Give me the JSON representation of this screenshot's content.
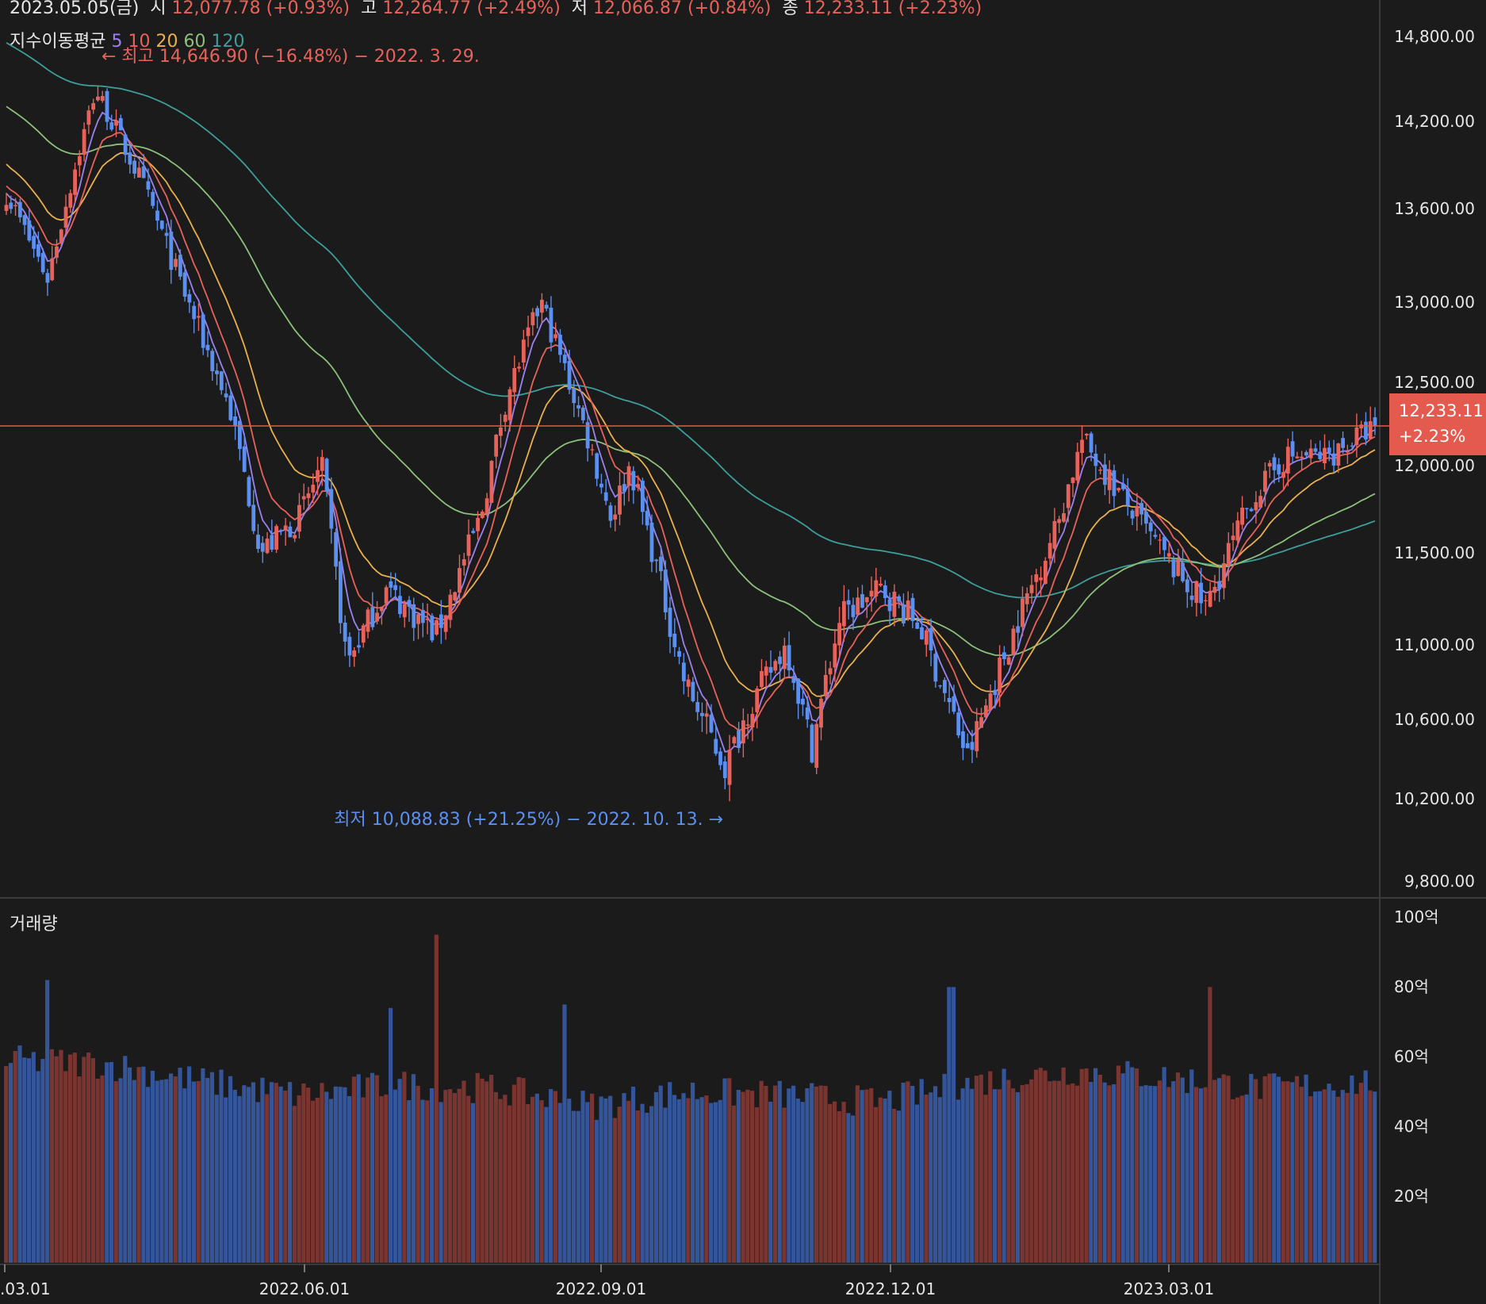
{
  "header": {
    "date": "2023.05.05(금)",
    "open_label": "시",
    "open_value": "12,077.78 (+0.93%)",
    "high_label": "고",
    "high_value": "12,264.77 (+2.49%)",
    "low_label": "저",
    "low_value": "12,066.87 (+0.84%)",
    "close_label": "종",
    "close_value": "12,233.11 (+2.23%)"
  },
  "ma_legend": {
    "title": "지수이동평균",
    "items": [
      {
        "label": "5",
        "color": "#9b82f0"
      },
      {
        "label": "10",
        "color": "#e8625a"
      },
      {
        "label": "20",
        "color": "#eab04c"
      },
      {
        "label": "60",
        "color": "#8cc07a"
      },
      {
        "label": "120",
        "color": "#3d9e9a"
      }
    ]
  },
  "colors": {
    "up": "#e8625a",
    "down": "#5b8ff0",
    "vol_up": "#7a3530",
    "vol_down": "#34559a",
    "background": "#1b1b1c",
    "grid_line": "#3a3a3c"
  },
  "annotations": {
    "high": "← 최고 14,646.90 (−16.48%) − 2022. 3. 29.",
    "low": "최저 10,088.83 (+21.25%) − 2022. 10. 13. →"
  },
  "last_price": {
    "value": "12,233.11",
    "change": "+2.23%"
  },
  "volume_label": "거래량",
  "chart_data": [
    {
      "type": "candlestick",
      "title": "",
      "x_ticks": [
        ".03.01",
        "2022.06.01",
        "2022.09.01",
        "2022.12.01",
        "2023.03.01"
      ],
      "y_ticks": [
        "14,800.00",
        "14,200.00",
        "13,600.00",
        "13,000.00",
        "12,500.00",
        "12,000.00",
        "11,500.00",
        "11,000.00",
        "10,600.00",
        "10,200.00",
        "9,800.00"
      ],
      "y_axis_note": "non-linear price scale as printed",
      "close_path": [
        {
          "date": "2022-03-01",
          "close": 13700
        },
        {
          "date": "2022-03-14",
          "close": 13150
        },
        {
          "date": "2022-03-29",
          "close": 14420
        },
        {
          "date": "2022-04-12",
          "close": 13800
        },
        {
          "date": "2022-04-26",
          "close": 13050
        },
        {
          "date": "2022-05-10",
          "close": 12350
        },
        {
          "date": "2022-05-20",
          "close": 11500
        },
        {
          "date": "2022-06-01",
          "close": 11700
        },
        {
          "date": "2022-06-08",
          "close": 12000
        },
        {
          "date": "2022-06-16",
          "close": 10900
        },
        {
          "date": "2022-06-28",
          "close": 11300
        },
        {
          "date": "2022-07-14",
          "close": 11050
        },
        {
          "date": "2022-07-28",
          "close": 11700
        },
        {
          "date": "2022-08-05",
          "close": 12400
        },
        {
          "date": "2022-08-16",
          "close": 13000
        },
        {
          "date": "2022-08-30",
          "close": 12200
        },
        {
          "date": "2022-09-07",
          "close": 11700
        },
        {
          "date": "2022-09-13",
          "close": 12000
        },
        {
          "date": "2022-09-30",
          "close": 10800
        },
        {
          "date": "2022-10-13",
          "close": 10350
        },
        {
          "date": "2022-10-20",
          "close": 10650
        },
        {
          "date": "2022-11-01",
          "close": 11000
        },
        {
          "date": "2022-11-09",
          "close": 10450
        },
        {
          "date": "2022-11-18",
          "close": 11150
        },
        {
          "date": "2022-12-01",
          "close": 11300
        },
        {
          "date": "2022-12-13",
          "close": 11100
        },
        {
          "date": "2022-12-28",
          "close": 10400
        },
        {
          "date": "2023-01-12",
          "close": 11100
        },
        {
          "date": "2023-01-25",
          "close": 11650
        },
        {
          "date": "2023-02-02",
          "close": 12150
        },
        {
          "date": "2023-02-15",
          "close": 11800
        },
        {
          "date": "2023-03-01",
          "close": 11450
        },
        {
          "date": "2023-03-13",
          "close": 11200
        },
        {
          "date": "2023-03-27",
          "close": 11800
        },
        {
          "date": "2023-04-07",
          "close": 12050
        },
        {
          "date": "2023-04-20",
          "close": 12050
        },
        {
          "date": "2023-05-05",
          "close": 12233.11
        }
      ],
      "ma_end_values": {
        "5": 12070,
        "10": 12020,
        "20": 12010,
        "60": 11820,
        "120": 11670
      },
      "last_close": 12233.11
    },
    {
      "type": "bar",
      "title": "",
      "y_ticks": [
        "100억",
        "80억",
        "60억",
        "40억",
        "20억"
      ],
      "ylim": [
        0,
        100
      ],
      "unit": "억",
      "volume_path": [
        {
          "date": "2022-03-01",
          "value": 58
        },
        {
          "date": "2022-04-01",
          "value": 57
        },
        {
          "date": "2022-05-01",
          "value": 52
        },
        {
          "date": "2022-06-01",
          "value": 48
        },
        {
          "date": "2022-07-01",
          "value": 51
        },
        {
          "date": "2022-08-01",
          "value": 50
        },
        {
          "date": "2022-09-01",
          "value": 45
        },
        {
          "date": "2022-10-01",
          "value": 49
        },
        {
          "date": "2022-11-01",
          "value": 48
        },
        {
          "date": "2022-12-01",
          "value": 46
        },
        {
          "date": "2023-01-01",
          "value": 52
        },
        {
          "date": "2023-02-01",
          "value": 55
        },
        {
          "date": "2023-03-01",
          "value": 53
        },
        {
          "date": "2023-04-01",
          "value": 50
        },
        {
          "date": "2023-05-05",
          "value": 52
        }
      ],
      "spikes": [
        {
          "date": "2022-03-14",
          "value": 81
        },
        {
          "date": "2022-06-30",
          "value": 73
        },
        {
          "date": "2022-07-14",
          "value": 94
        },
        {
          "date": "2022-08-24",
          "value": 74
        },
        {
          "date": "2022-12-23",
          "value": 79
        },
        {
          "date": "2023-03-14",
          "value": 79
        }
      ]
    }
  ]
}
